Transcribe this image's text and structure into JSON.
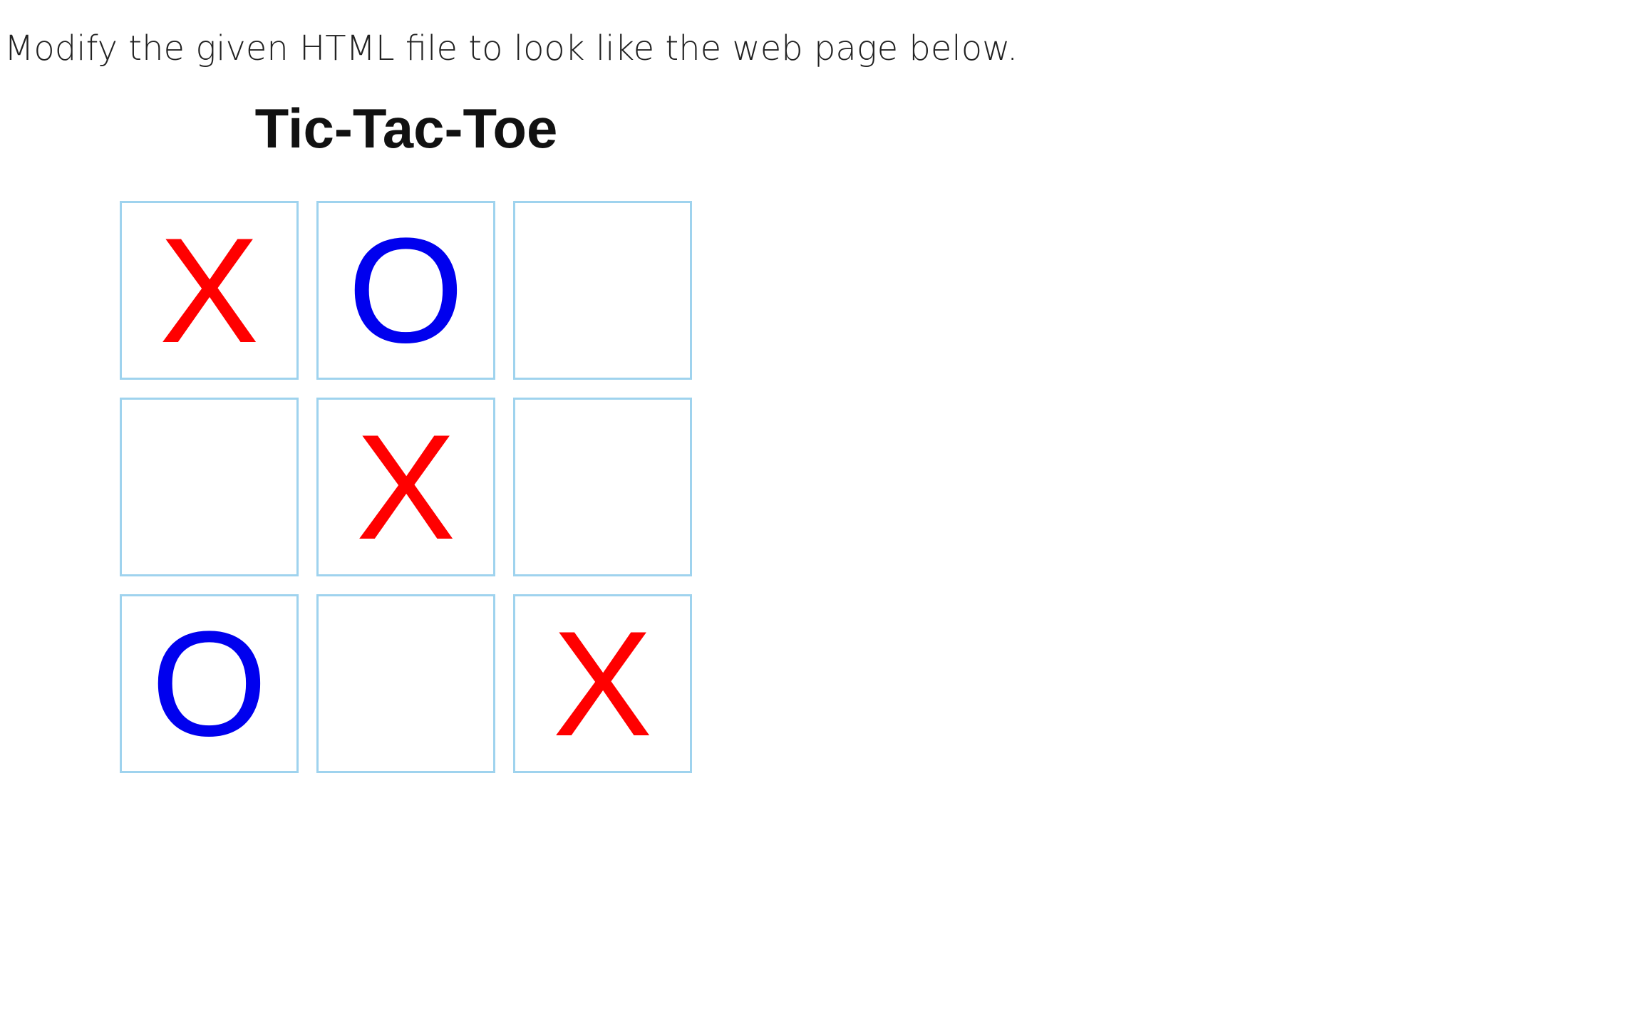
{
  "instruction": "Modify the given HTML file to look like the web page below.",
  "game": {
    "title": "Tic-Tac-Toe",
    "colors": {
      "x_mark": "#ff0000",
      "o_mark": "#0000ee",
      "cell_border": "#9fd3ee"
    },
    "board": [
      [
        "X",
        "O",
        ""
      ],
      [
        "",
        "X",
        ""
      ],
      [
        "O",
        "",
        "X"
      ]
    ]
  }
}
